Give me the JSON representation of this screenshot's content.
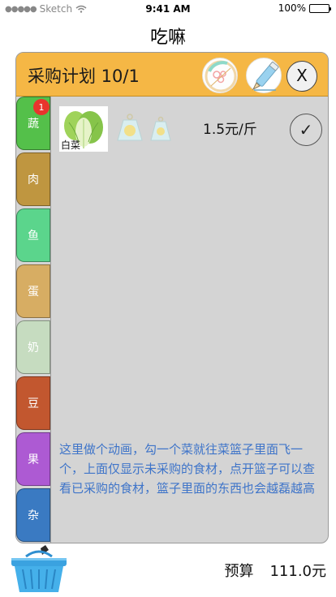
{
  "status_bar": {
    "carrier": "Sketch",
    "time": "9:41 AM",
    "battery": "100%"
  },
  "app": {
    "title": "吃嘛"
  },
  "plan": {
    "title": "采购计划 10/1",
    "close_label": "X"
  },
  "categories": [
    {
      "label": "蔬",
      "color": "#54c04a",
      "badge": "1"
    },
    {
      "label": "肉",
      "color": "#bf9640"
    },
    {
      "label": "鱼",
      "color": "#5bd58c"
    },
    {
      "label": "蛋",
      "color": "#d7ad63"
    },
    {
      "label": "奶",
      "color": "#c6dcc0"
    },
    {
      "label": "豆",
      "color": "#c2572f"
    },
    {
      "label": "果",
      "color": "#ad5ad3"
    },
    {
      "label": "杂",
      "color": "#3a7ac2"
    }
  ],
  "items": [
    {
      "name": "白菜",
      "price": "1.5元/斤",
      "check": "✓"
    }
  ],
  "note": "这里做个动画，勾一个菜就往菜篮子里面飞一个，上面仅显示未采购的食材，点开篮子可以查看已采购的食材，篮子里面的东西也会越磊越高",
  "budget": {
    "label": "预算",
    "value": "111.0元"
  },
  "colors": {
    "header": "#f5b745",
    "content_bg": "#d4d4d4",
    "note_text": "#3e74c9",
    "badge": "#e8342d"
  }
}
